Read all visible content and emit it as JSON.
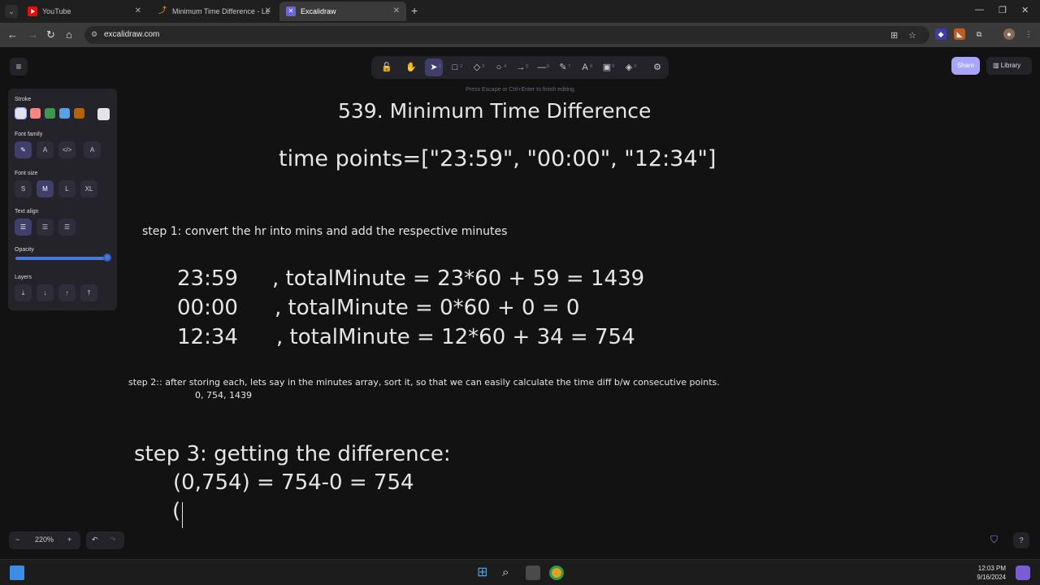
{
  "browser": {
    "tab_menu_icon": "chevron-down-icon",
    "tabs": [
      {
        "title": "YouTube",
        "favicon": "youtube-icon"
      },
      {
        "title": "Minimum Time Difference - Le",
        "favicon": "leetcode-icon"
      },
      {
        "title": "Excalidraw",
        "favicon": "excalidraw-icon"
      }
    ],
    "new_tab": "+",
    "url": "excalidraw.com"
  },
  "app": {
    "share_label": "Share",
    "library_label": "Library",
    "hint": "Press Escape or Ctrl+Enter to finish editing",
    "tools": [
      {
        "icon": "lock-icon",
        "glyph": "🔓",
        "key": ""
      },
      {
        "icon": "hand-icon",
        "glyph": "✋",
        "key": ""
      },
      {
        "icon": "selection-icon",
        "glyph": "➤",
        "key": "1"
      },
      {
        "icon": "rectangle-icon",
        "glyph": "□",
        "key": "2"
      },
      {
        "icon": "diamond-icon",
        "glyph": "◇",
        "key": "3"
      },
      {
        "icon": "ellipse-icon",
        "glyph": "○",
        "key": "4"
      },
      {
        "icon": "arrow-icon",
        "glyph": "→",
        "key": "5"
      },
      {
        "icon": "line-icon",
        "glyph": "—",
        "key": "6"
      },
      {
        "icon": "pencil-icon",
        "glyph": "✎",
        "key": "7"
      },
      {
        "icon": "text-icon",
        "glyph": "A",
        "key": "8"
      },
      {
        "icon": "image-icon",
        "glyph": "▣",
        "key": "9"
      },
      {
        "icon": "eraser-icon",
        "glyph": "◈",
        "key": "0"
      },
      {
        "icon": "more-tools-icon",
        "glyph": "⚙",
        "key": ""
      }
    ],
    "properties": {
      "stroke_label": "Stroke",
      "stroke_colors": [
        "#e3e3e8",
        "#ff8383",
        "#3a994c",
        "#56a2e8",
        "#b76100",
        "#e3e3e8"
      ],
      "font_family_label": "Font family",
      "font_size_label": "Font size",
      "font_sizes": [
        "S",
        "M",
        "L",
        "XL"
      ],
      "text_align_label": "Text align",
      "opacity_label": "Opacity",
      "opacity": 100,
      "layers_label": "Layers"
    },
    "zoom": "220%",
    "zoom_out": "−",
    "zoom_in": "+"
  },
  "drawing": {
    "title": "539. Minimum Time Difference",
    "timepoints": "time points=[\"23:59\", \"00:00\", \"12:34\"]",
    "step1": "step 1: convert the hr into mins and add the respective minutes",
    "rows": [
      {
        "time": "23:59",
        "calc": ", totalMinute = 23*60 + 59 = 1439"
      },
      {
        "time": "00:00",
        "calc": ", totalMinute = 0*60 + 0 = 0"
      },
      {
        "time": "12:34",
        "calc": ", totalMinute = 12*60 + 34 = 754"
      }
    ],
    "step2": "step 2:: after storing each, lets say in the minutes array, sort it, so that we can easily calculate the time diff b/w consecutive points.",
    "sorted": "0, 754, 1439",
    "step3": "step 3: getting the difference:",
    "diff1": "(0,754) = 754-0 = 754",
    "diff2": "("
  },
  "taskbar": {
    "time": "12:03 PM",
    "date": "9/16/2024"
  }
}
